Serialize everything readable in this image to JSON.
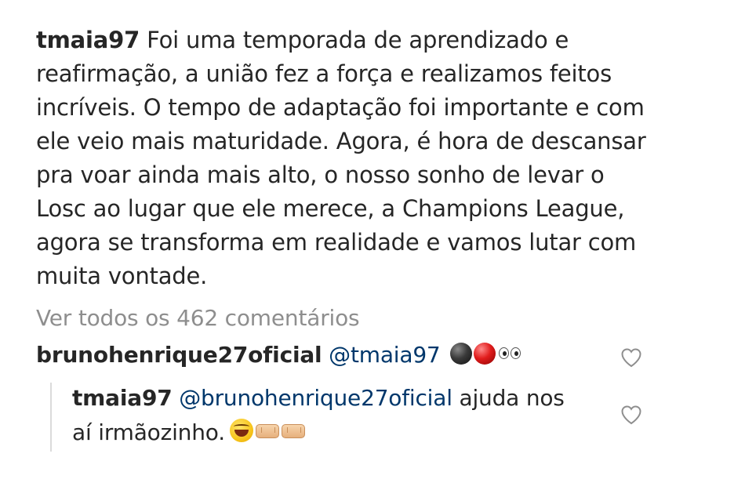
{
  "post": {
    "username": "tmaia97",
    "caption": "Foi uma temporada de aprendizado e reafirmação, a união fez a força e realizamos feitos incríveis. O tempo de adaptação foi importante e com ele veio mais maturidade. Agora, é hora de descansar pra voar ainda mais alto, o nosso sonho de levar o Losc ao lugar que ele merece, a Champions League, agora se transforma em realidade e vamos lutar com muita vontade."
  },
  "view_all_comments": "Ver todos os 462 comentários",
  "comments": [
    {
      "username": "brunohenrique27oficial",
      "mention": "@tmaia97",
      "text": "",
      "emojis": [
        "black-ball-emoji",
        "red-ball-emoji",
        "eyes-emoji"
      ],
      "like_icon": "heart-outline-icon"
    }
  ],
  "replies": [
    {
      "username": "tmaia97",
      "mention": "@brunohenrique27oficial",
      "text": "ajuda nos",
      "text_line2": "aí irmãozinho.",
      "emojis": [
        "rolling-laughing-emoji",
        "fist-bump-left-emoji",
        "fist-bump-right-emoji"
      ],
      "like_icon": "heart-outline-icon"
    }
  ],
  "colors": {
    "text": "#262626",
    "muted": "#8e8e8e",
    "mention": "#00376b",
    "thread_line": "#dbdbdb"
  }
}
